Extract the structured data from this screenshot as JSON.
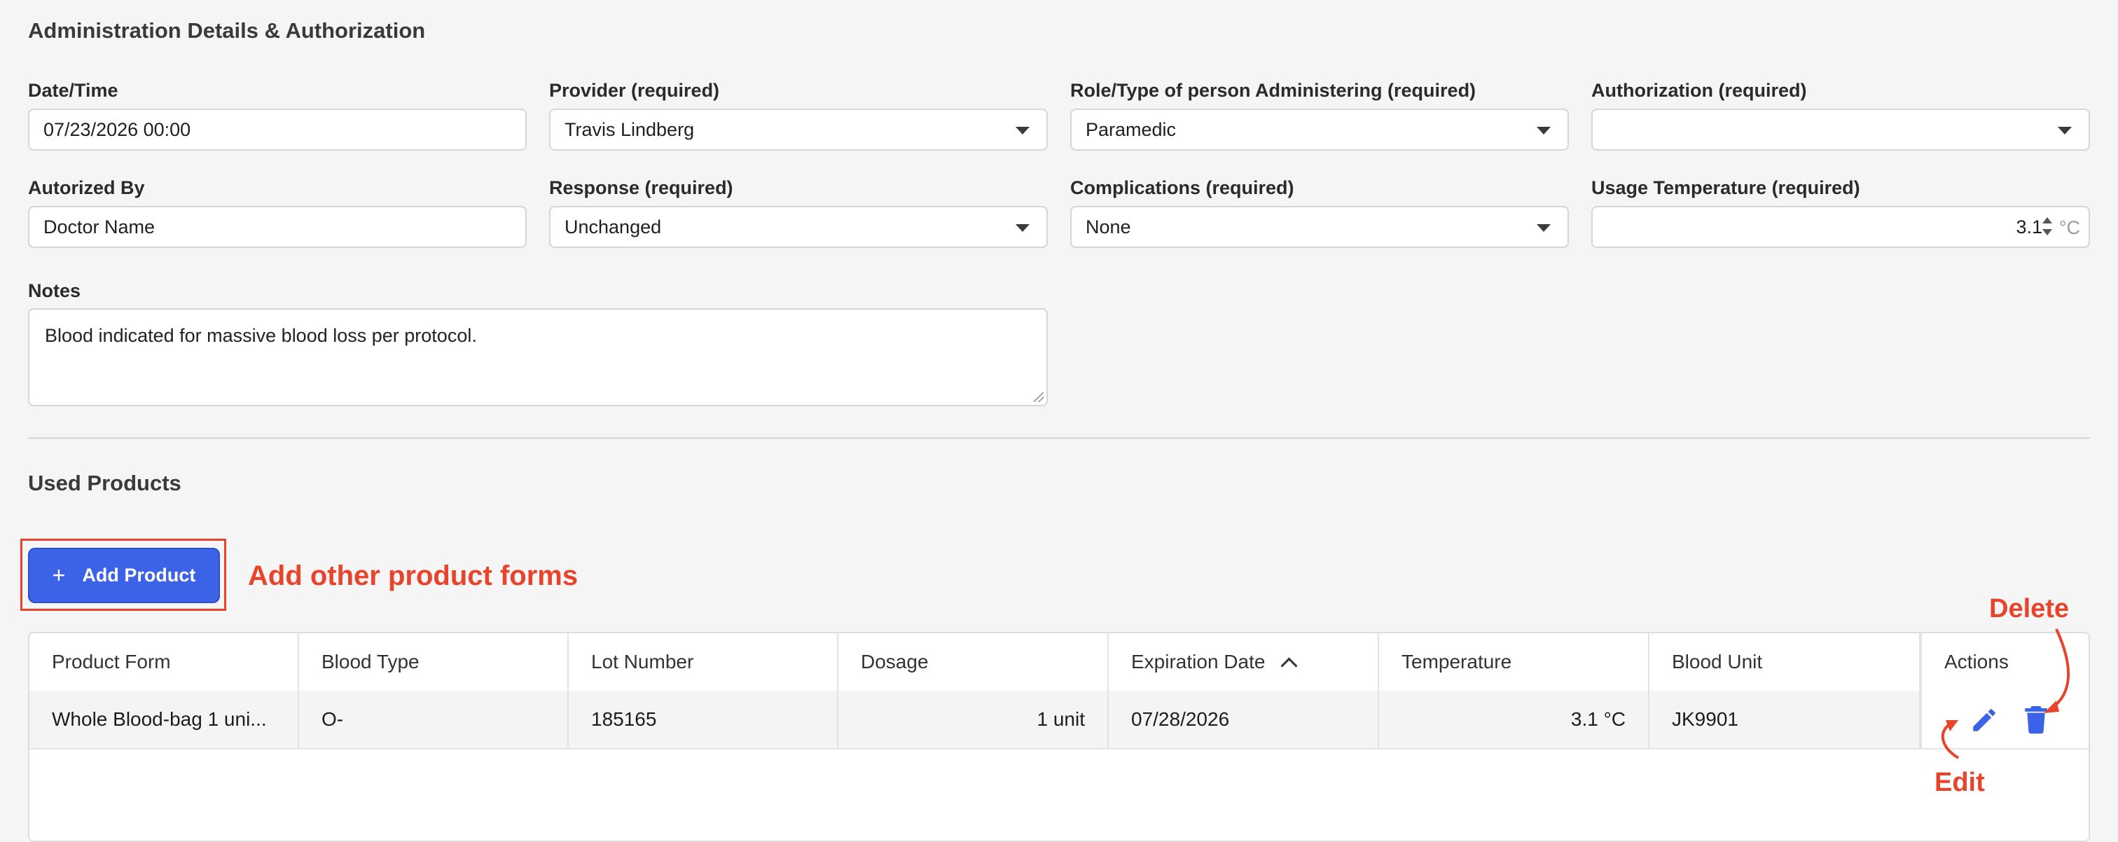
{
  "section": {
    "admin_title": "Administration Details & Authorization",
    "used_products_title": "Used Products"
  },
  "form": {
    "datetime": {
      "label": "Date/Time",
      "value": "07/23/2026 00:00"
    },
    "provider": {
      "label": "Provider (required)",
      "value": "Travis Lindberg"
    },
    "role": {
      "label": "Role/Type of person Administering (required)",
      "value": "Paramedic"
    },
    "authorization": {
      "label": "Authorization (required)",
      "value": ""
    },
    "authorized_by": {
      "label": "Autorized By",
      "value": "Doctor Name"
    },
    "response": {
      "label": "Response (required)",
      "value": "Unchanged"
    },
    "complications": {
      "label": "Complications (required)",
      "value": "None"
    },
    "usage_temperature": {
      "label": "Usage Temperature (required)",
      "value": "3.1",
      "unit": "°C"
    },
    "notes": {
      "label": "Notes",
      "value": "Blood indicated for massive blood loss per protocol."
    }
  },
  "add_product": {
    "label": "Add Product",
    "icon": "plus-icon"
  },
  "annotations": {
    "add_forms": "Add other product forms",
    "delete": "Delete",
    "edit": "Edit",
    "color": "#e8432b"
  },
  "table": {
    "columns": [
      "Product Form",
      "Blood Type",
      "Lot Number",
      "Dosage",
      "Expiration Date",
      "Temperature",
      "Blood Unit",
      "Actions"
    ],
    "sorted_column": "Expiration Date",
    "sort_direction": "ascending",
    "rows": [
      {
        "product_form": "Whole Blood-bag 1 uni...",
        "blood_type": "O-",
        "lot_number": "185165",
        "dosage": "1 unit",
        "expiration_date": "07/28/2026",
        "temperature": "3.1 °C",
        "blood_unit": "JK9901"
      }
    ],
    "action_icons": [
      "edit-pencil-icon",
      "delete-trash-icon"
    ]
  },
  "colors": {
    "accent": "#3c62e8",
    "annotation": "#e8432b",
    "background": "#f5f5f5"
  }
}
